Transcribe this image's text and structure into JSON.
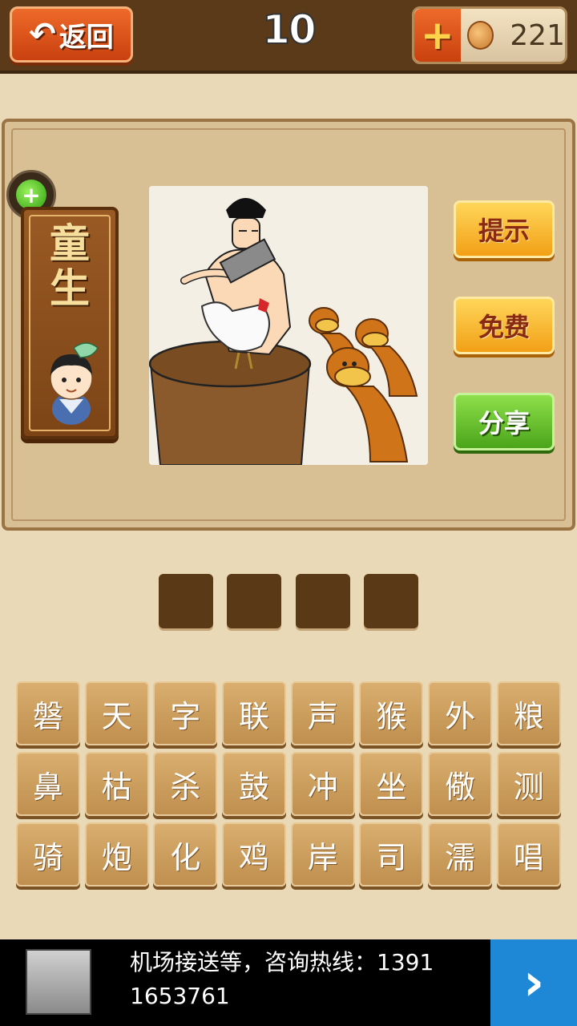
{
  "header": {
    "back_label": "返回",
    "level": "10",
    "coins": "221",
    "plus_label": "+"
  },
  "character": {
    "title": "童生"
  },
  "actions": {
    "hint": "提示",
    "free": "免费",
    "share": "分享"
  },
  "answer_slots": 4,
  "letters": [
    "磐",
    "天",
    "字",
    "联",
    "声",
    "猴",
    "外",
    "粮",
    "鼻",
    "枯",
    "杀",
    "鼓",
    "冲",
    "坐",
    "儆",
    "测",
    "骑",
    "炮",
    "化",
    "鸡",
    "岸",
    "司",
    "濡",
    "唱"
  ],
  "ad": {
    "text": "机场接送等，咨询热线：1391 1653761",
    "arrow": "›"
  },
  "icons": {
    "back": "back-arrow-icon",
    "coin": "coin-icon",
    "add": "add-circle-icon",
    "ad_next": "chevron-right-icon"
  },
  "colors": {
    "background": "#ead9b6",
    "top_bar": "#5a3a18",
    "hint_button": "#f2a016",
    "share_button": "#4aa41a",
    "key_tile": "#c99a5a",
    "ad_accent": "#1e88d6"
  }
}
